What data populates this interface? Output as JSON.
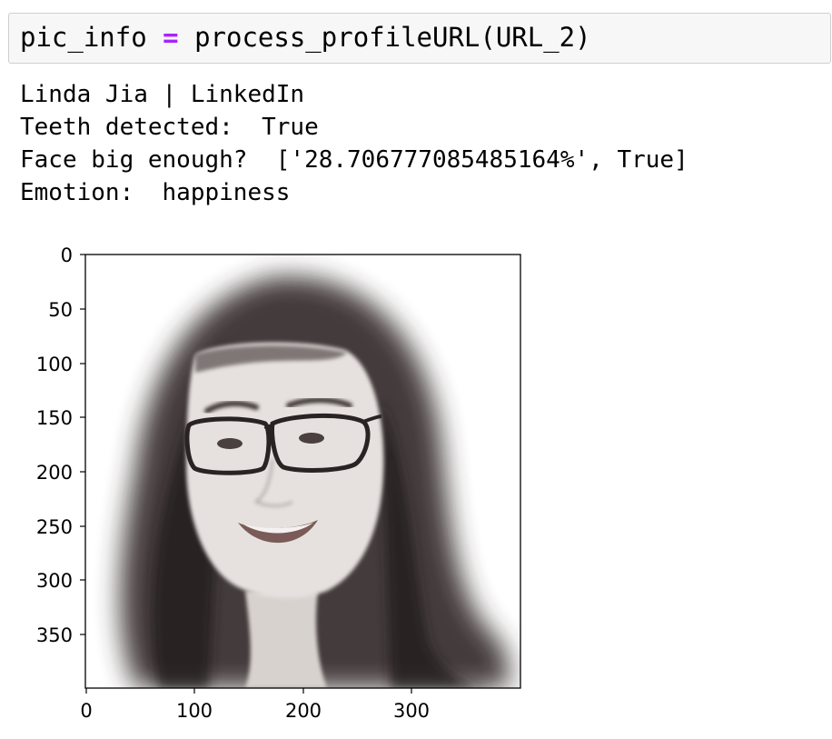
{
  "input_cell": {
    "var": "pic_info",
    "op": "=",
    "call": "process_profileURL(URL_2)"
  },
  "output": {
    "lines": [
      "Linda Jia | LinkedIn",
      "Teeth detected:  True",
      "Face big enough?  ['28.706777085485164%', True]",
      "Emotion:  happiness"
    ]
  },
  "chart_data": {
    "type": "image",
    "image_description": "grayscale portrait photo of a smiling woman with glasses, background blurred",
    "x_ticks": [
      "0",
      "100",
      "200",
      "300"
    ],
    "y_ticks": [
      "0",
      "50",
      "100",
      "150",
      "200",
      "250",
      "300",
      "350"
    ],
    "xlim": [
      0,
      400
    ],
    "ylim": [
      400,
      0
    ]
  }
}
